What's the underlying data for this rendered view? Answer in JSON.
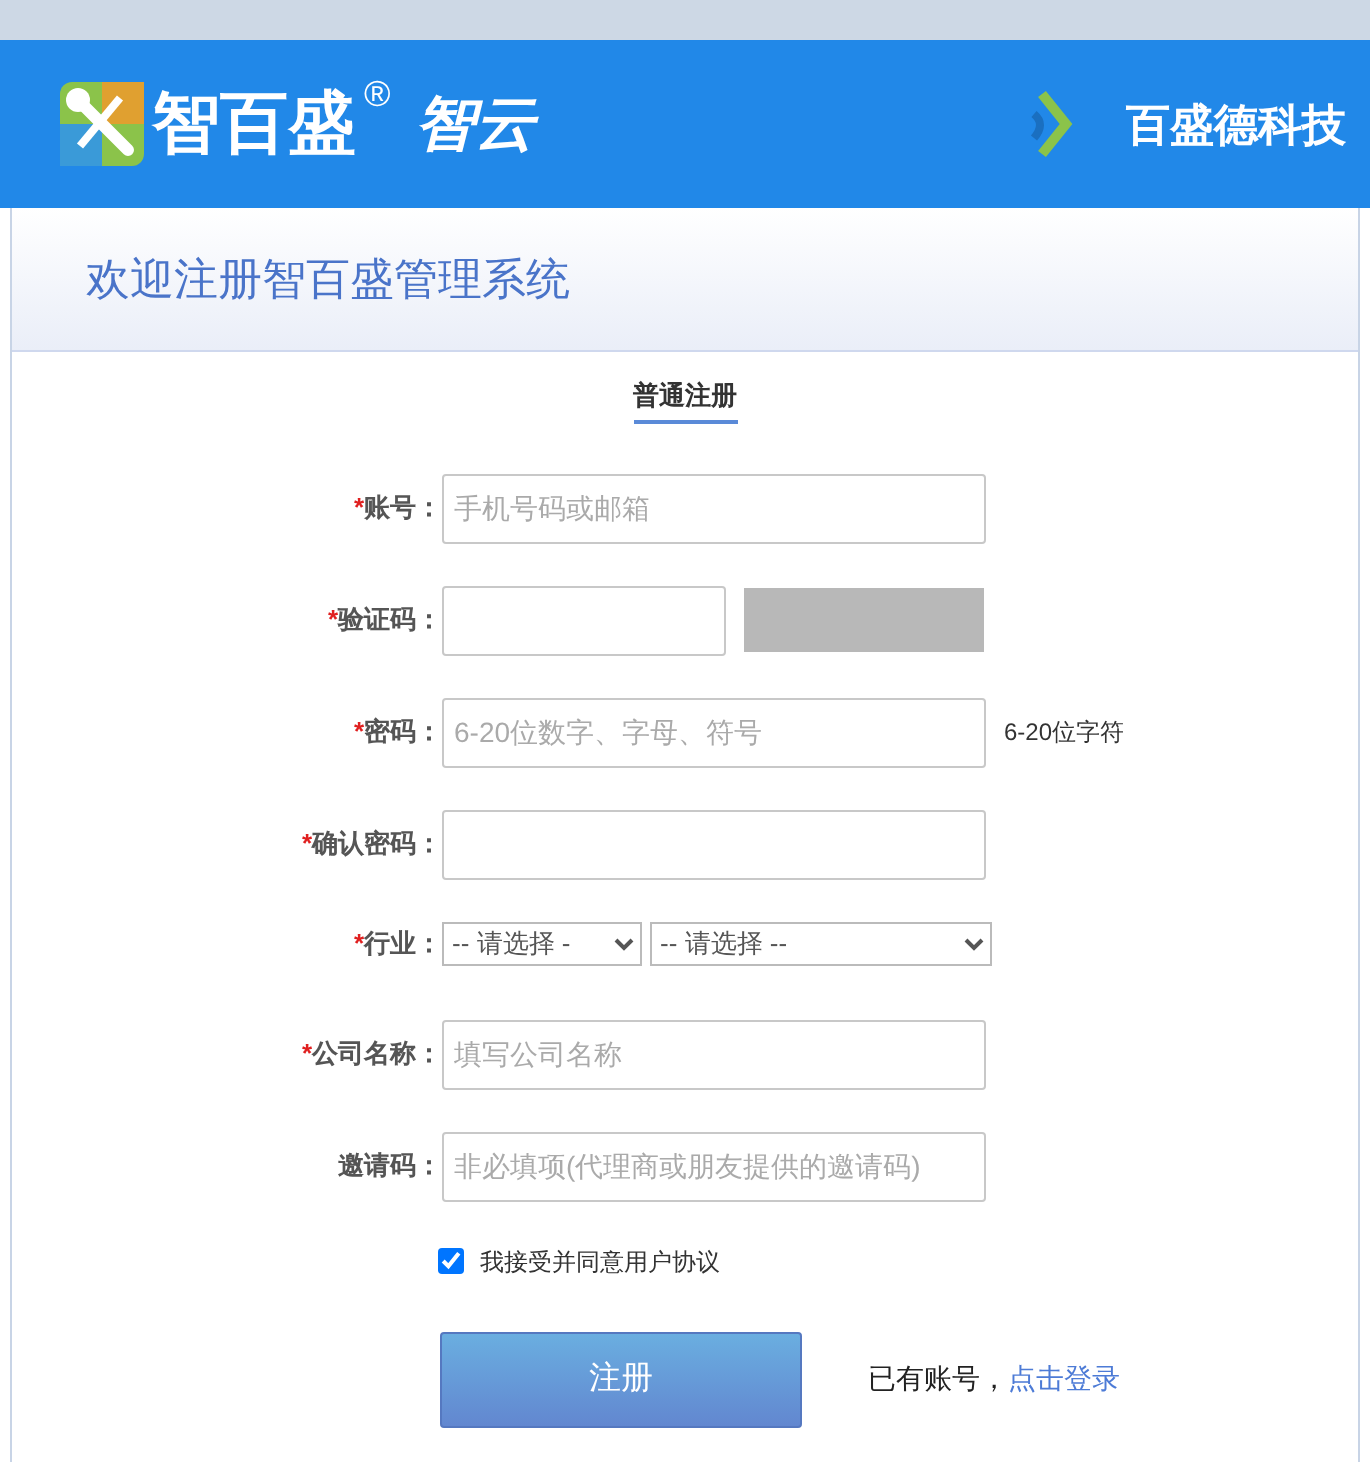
{
  "header": {
    "brand": "智百盛",
    "registered": "®",
    "brand_suffix": "智云",
    "company": "百盛德科技"
  },
  "title": "欢迎注册智百盛管理系统",
  "tabs": [
    {
      "label": "普通注册",
      "selected": true
    }
  ],
  "fields": [
    {
      "kind": "text",
      "marker": "*",
      "label": "账号：",
      "placeholder": "手机号码或邮箱"
    },
    {
      "kind": "captcha",
      "marker": "*",
      "label": "验证码："
    },
    {
      "kind": "text",
      "marker": "*",
      "label": "密码：",
      "placeholder": "6-20位数字、字母、符号",
      "hint": "6-20位字符"
    },
    {
      "kind": "text",
      "marker": "*",
      "label": "确认密码："
    },
    {
      "kind": "selects",
      "marker": "*",
      "label": "行业：",
      "options": [
        "-- 请选择 -",
        "-- 请选择 --"
      ]
    },
    {
      "kind": "text",
      "marker": "*",
      "label": "公司名称：",
      "placeholder": "填写公司名称"
    },
    {
      "kind": "text",
      "label": "邀请码：",
      "placeholder": "非必填项(代理商或朋友提供的邀请码)"
    }
  ],
  "agreement": {
    "label": "我接受并同意用户协议",
    "checked": true
  },
  "submit": "注册",
  "login_prompt": "已有账号，",
  "login_link": "点击登录"
}
